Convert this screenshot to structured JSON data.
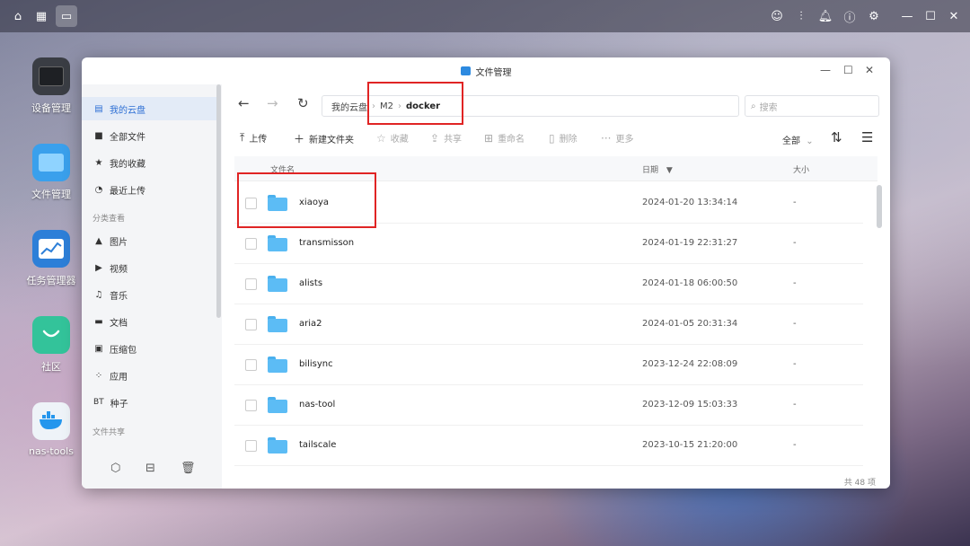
{
  "desktop_icons": [
    {
      "label": "设备管理",
      "icon": "device-manager-icon"
    },
    {
      "label": "文件管理",
      "icon": "file-manager-icon"
    },
    {
      "label": "任务管理器",
      "icon": "task-manager-icon"
    },
    {
      "label": "社区",
      "icon": "community-icon"
    },
    {
      "label": "nas-tools",
      "icon": "docker-whale-icon"
    }
  ],
  "window": {
    "title": "文件管理"
  },
  "sidebar": {
    "items": [
      {
        "label": "我的云盘",
        "icon": "cloud-drive-icon"
      },
      {
        "label": "全部文件",
        "icon": "folder-icon"
      },
      {
        "label": "我的收藏",
        "icon": "star-icon"
      },
      {
        "label": "最近上传",
        "icon": "clock-icon"
      }
    ],
    "category_heading": "分类查看",
    "categories": [
      {
        "label": "图片",
        "icon": "picture-icon"
      },
      {
        "label": "视频",
        "icon": "video-icon"
      },
      {
        "label": "音乐",
        "icon": "headphones-icon"
      },
      {
        "label": "文档",
        "icon": "document-icon"
      },
      {
        "label": "压缩包",
        "icon": "archive-icon"
      },
      {
        "label": "应用",
        "icon": "apps-icon"
      },
      {
        "label": "种子",
        "icon": "bt-torrent-icon",
        "prefix": "BT"
      }
    ],
    "share_heading": "文件共享"
  },
  "breadcrumb": {
    "items": [
      "我的云盘",
      "M2",
      "docker"
    ]
  },
  "search": {
    "placeholder": "搜索"
  },
  "toolbar": {
    "upload": "上传",
    "new_folder": "新建文件夹",
    "favorite": "收藏",
    "share": "共享",
    "rename": "重命名",
    "delete": "删除",
    "more": "更多",
    "filter": "全部"
  },
  "table": {
    "columns": {
      "name": "文件名",
      "date": "日期",
      "size": "大小"
    },
    "rows": [
      {
        "name": "xiaoya",
        "date": "2024-01-20 13:34:14",
        "size": "-"
      },
      {
        "name": "transmisson",
        "date": "2024-01-19 22:31:27",
        "size": "-"
      },
      {
        "name": "alists",
        "date": "2024-01-18 06:00:50",
        "size": "-"
      },
      {
        "name": "aria2",
        "date": "2024-01-05 20:31:34",
        "size": "-"
      },
      {
        "name": "bilisync",
        "date": "2023-12-24 22:08:09",
        "size": "-"
      },
      {
        "name": "nas-tool",
        "date": "2023-12-09 15:03:33",
        "size": "-"
      },
      {
        "name": "tailscale",
        "date": "2023-10-15 21:20:00",
        "size": "-"
      }
    ]
  },
  "footer": {
    "count": "共 48 项"
  },
  "colors": {
    "accent": "#2d6fd4",
    "folder": "#5cbcf5",
    "highlight": "#e02424"
  }
}
